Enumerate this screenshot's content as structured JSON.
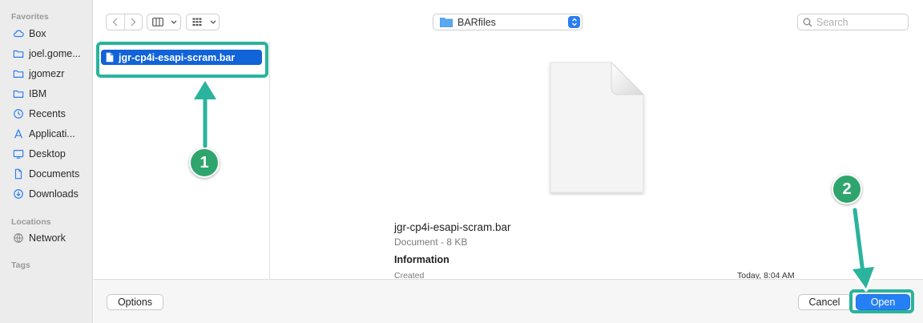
{
  "sidebar": {
    "favorites_heading": "Favorites",
    "locations_heading": "Locations",
    "tags_heading": "Tags",
    "favorites": [
      {
        "label": "Box",
        "icon": "cloud-icon"
      },
      {
        "label": "joel.gome...",
        "icon": "folder-icon"
      },
      {
        "label": "jgomezr",
        "icon": "folder-icon"
      },
      {
        "label": "IBM",
        "icon": "folder-icon"
      },
      {
        "label": "Recents",
        "icon": "clock-icon"
      },
      {
        "label": "Applicati...",
        "icon": "applications-icon"
      },
      {
        "label": "Desktop",
        "icon": "desktop-icon"
      },
      {
        "label": "Documents",
        "icon": "document-icon"
      },
      {
        "label": "Downloads",
        "icon": "download-icon"
      }
    ],
    "locations": [
      {
        "label": "Network",
        "icon": "network-icon"
      }
    ]
  },
  "toolbar": {
    "current_folder": "BARfiles",
    "search_placeholder": "Search"
  },
  "column": {
    "selected_file": "jgr-cp4i-esapi-scram.bar"
  },
  "preview": {
    "name": "jgr-cp4i-esapi-scram.bar",
    "kind_size": "Document - 8 KB",
    "info_heading": "Information",
    "created_label": "Created",
    "created_value": "Today, 8:04 AM"
  },
  "buttons": {
    "options": "Options",
    "cancel": "Cancel",
    "open": "Open"
  },
  "annotations": {
    "step1": "1",
    "step2": "2"
  },
  "colors": {
    "accent_blue": "#2680f5",
    "selection_blue": "#1163d8",
    "annotation_teal": "#2ab39d",
    "badge_green": "#2fa56d"
  }
}
